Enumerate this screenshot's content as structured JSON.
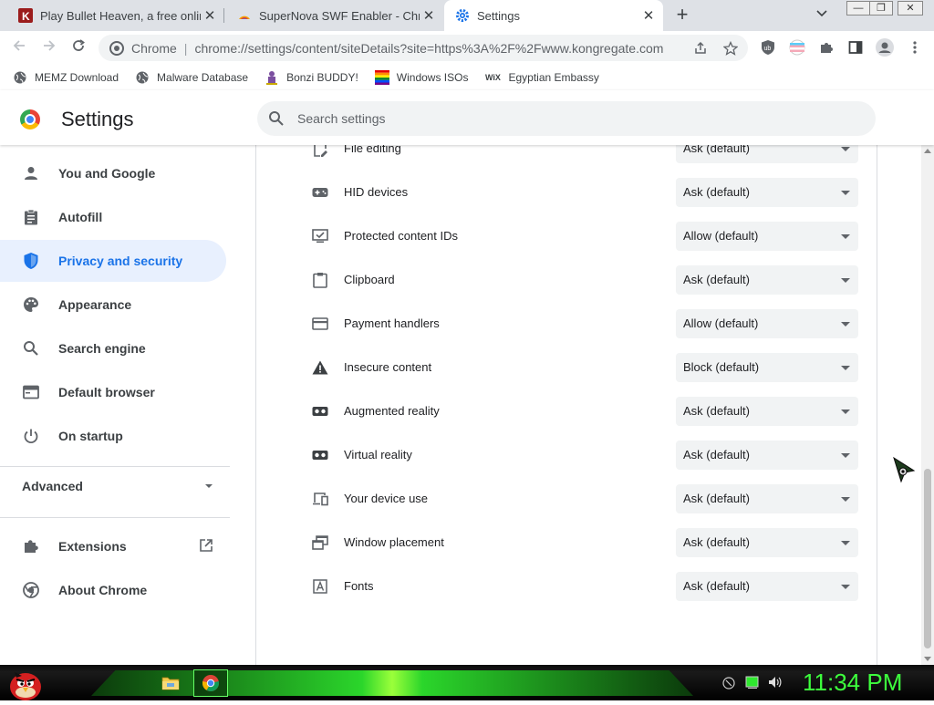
{
  "tabs": [
    {
      "title": "Play Bullet Heaven, a free online",
      "favicon": "kongregate-icon",
      "active": false
    },
    {
      "title": "SuperNova SWF Enabler - Chrom",
      "favicon": "supernova-icon",
      "active": false
    },
    {
      "title": "Settings",
      "favicon": "settings-gear-icon",
      "active": true
    }
  ],
  "toolbar": {
    "chip": "Chrome",
    "url": "chrome://settings/content/siteDetails?site=https%3A%2F%2Fwww.kongregate.com"
  },
  "bookmarks": [
    {
      "label": "MEMZ Download",
      "icon": "globe-icon"
    },
    {
      "label": "Malware Database",
      "icon": "globe-icon"
    },
    {
      "label": "Bonzi BUDDY!",
      "icon": "bonzi-icon"
    },
    {
      "label": "Windows ISOs",
      "icon": "windows-flag-icon"
    },
    {
      "label": "Egyptian Embassy",
      "icon": "wix-icon"
    }
  ],
  "header": {
    "title": "Settings",
    "search_placeholder": "Search settings"
  },
  "sidebar": {
    "items": [
      {
        "label": "You and Google",
        "icon": "person-icon"
      },
      {
        "label": "Autofill",
        "icon": "clipboard-icon"
      },
      {
        "label": "Privacy and security",
        "icon": "shield-icon",
        "active": true
      },
      {
        "label": "Appearance",
        "icon": "palette-icon"
      },
      {
        "label": "Search engine",
        "icon": "search-icon"
      },
      {
        "label": "Default browser",
        "icon": "browser-icon"
      },
      {
        "label": "On startup",
        "icon": "power-icon"
      }
    ],
    "advanced_label": "Advanced",
    "extensions_label": "Extensions",
    "about_label": "About Chrome"
  },
  "permissions": [
    {
      "label": "File editing",
      "value": "Ask (default)",
      "icon": "file-edit-icon"
    },
    {
      "label": "HID devices",
      "value": "Ask (default)",
      "icon": "gamepad-icon"
    },
    {
      "label": "Protected content IDs",
      "value": "Allow (default)",
      "icon": "monitor-check-icon"
    },
    {
      "label": "Clipboard",
      "value": "Ask (default)",
      "icon": "clipboard-icon"
    },
    {
      "label": "Payment handlers",
      "value": "Allow (default)",
      "icon": "credit-card-icon"
    },
    {
      "label": "Insecure content",
      "value": "Block (default)",
      "icon": "warning-icon"
    },
    {
      "label": "Augmented reality",
      "value": "Ask (default)",
      "icon": "vr-headset-icon"
    },
    {
      "label": "Virtual reality",
      "value": "Ask (default)",
      "icon": "vr-headset-icon"
    },
    {
      "label": "Your device use",
      "value": "Ask (default)",
      "icon": "devices-icon"
    },
    {
      "label": "Window placement",
      "value": "Ask (default)",
      "icon": "window-placement-icon"
    },
    {
      "label": "Fonts",
      "value": "Ask (default)",
      "icon": "font-icon"
    }
  ],
  "taskbar": {
    "clock": "11:34 PM"
  },
  "colors": {
    "accent": "#1a73e8",
    "active_nav_bg": "#e8f0fe",
    "clock": "#3dff3d"
  }
}
